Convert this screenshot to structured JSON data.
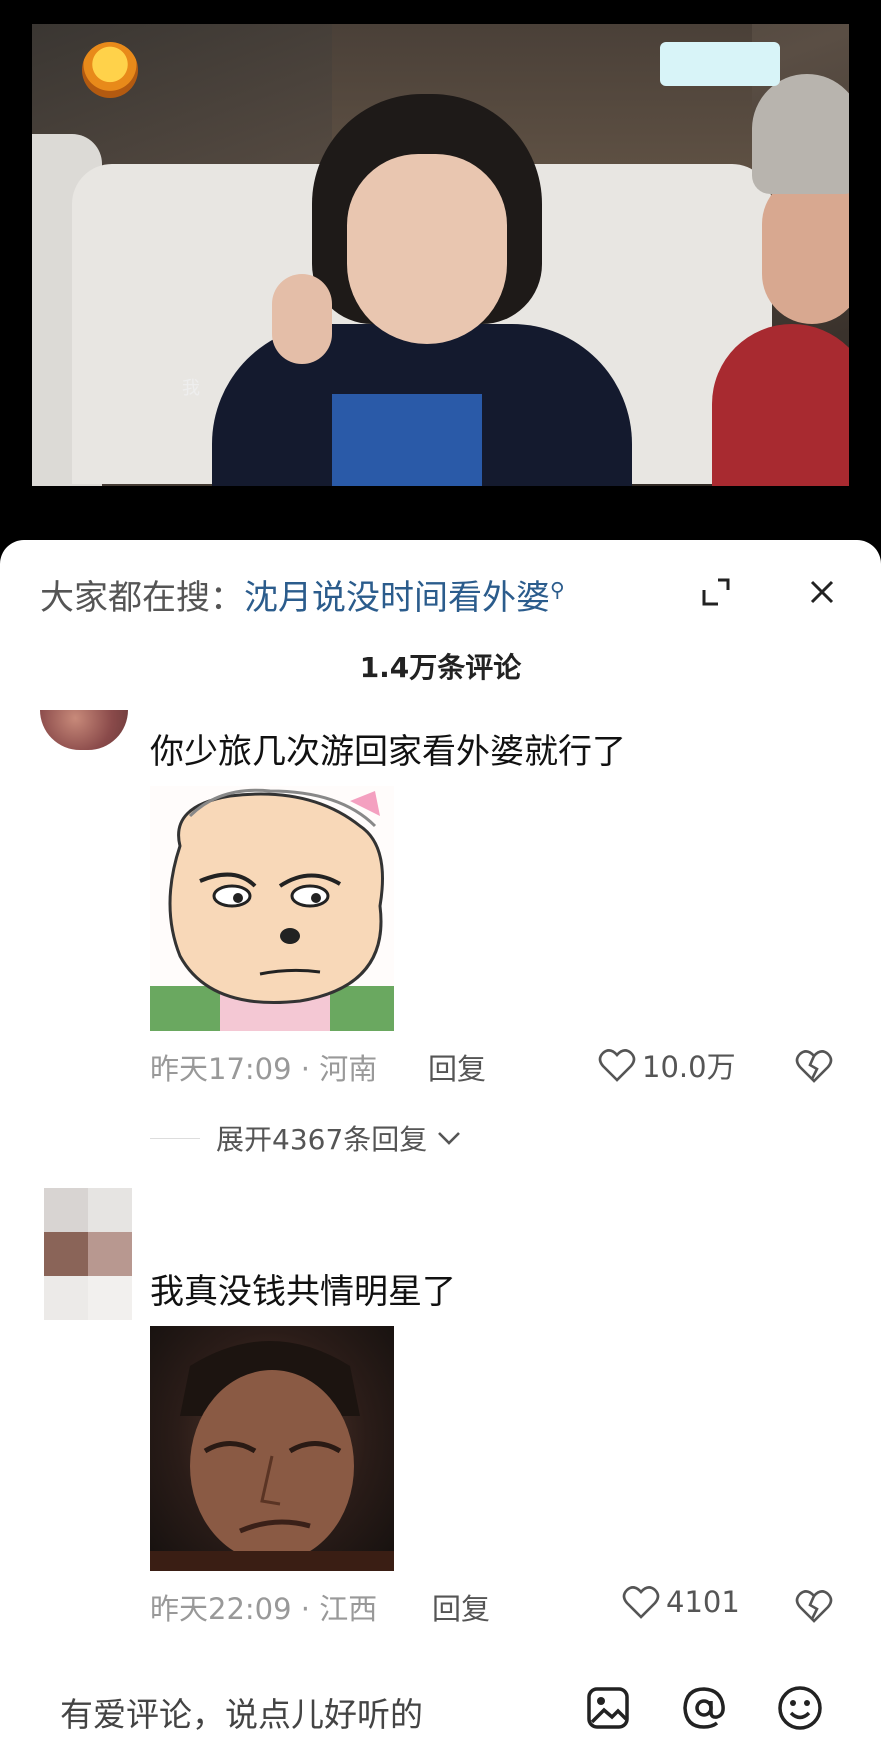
{
  "video": {
    "caption": "我",
    "colors": {
      "background": "#000000"
    }
  },
  "search": {
    "prefix": "大家都在搜：",
    "term": "沈月说没时间看外婆",
    "icon": "search-icon"
  },
  "comments_header": {
    "count_label": "1.4万条评论"
  },
  "comments": [
    {
      "text": "你少旅几次游回家看外婆就行了",
      "time": "昨天17:09",
      "sep": "·",
      "location": "河南",
      "reply_label": "回复",
      "likes": "10.0万",
      "expand_label": "展开4367条回复"
    },
    {
      "username": "​",
      "text": "我真没钱共情明星了",
      "time": "昨天22:09",
      "sep": "·",
      "location": "江西",
      "reply_label": "回复",
      "likes": "4101"
    }
  ],
  "composer": {
    "placeholder": "有爱评论，说点儿好听的",
    "icons": [
      "image-icon",
      "at-icon",
      "emoji-icon"
    ]
  },
  "colors": {
    "accent_link": "#2b5c8c",
    "meta_gray": "#999999",
    "text_main": "#111111"
  }
}
